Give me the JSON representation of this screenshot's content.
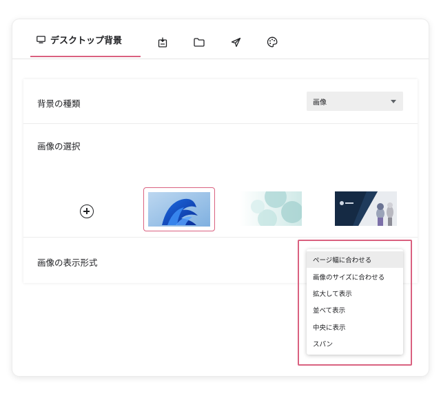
{
  "tabs": {
    "active_label": "デスクトップ背景",
    "icons": [
      "monitor-icon",
      "lock-screen-icon",
      "folder-icon",
      "send-icon",
      "palette-icon"
    ]
  },
  "background_type": {
    "label": "背景の種類",
    "value": "画像"
  },
  "image_select": {
    "label": "画像の選択",
    "add_icon": "plus-circle-icon",
    "thumbnails": [
      "windows-bloom-wallpaper",
      "teal-circles-wallpaper",
      "anime-characters-wallpaper"
    ],
    "selected_index": 0
  },
  "display_format": {
    "label": "画像の表示形式",
    "options": [
      "ページ幅に合わせる",
      "画像のサイズに合わせる",
      "拡大して表示",
      "並べて表示",
      "中央に表示",
      "スパン"
    ],
    "selected_index": 0
  },
  "colors": {
    "accent": "#d9607f"
  }
}
